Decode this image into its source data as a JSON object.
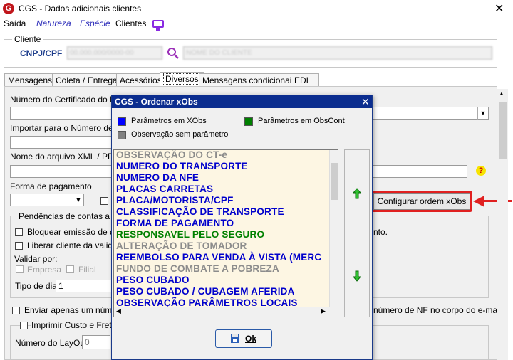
{
  "window": {
    "title": "CGS - Dados adicionais clientes",
    "close": "✕"
  },
  "menu": {
    "items": [
      "Saída",
      "Natureza",
      "Espécie",
      "Clientes"
    ]
  },
  "cliente": {
    "group_label": "Cliente",
    "cnpj_label": "CNPJ/CPF",
    "cnpj_value": "00.000.000/0000-00",
    "name_value": "NOME DO CLIENTE"
  },
  "tabs": [
    "Mensagens",
    "Coleta / Entrega",
    "Acessórios",
    "Diversos",
    "Mensagens condicionais",
    "EDI"
  ],
  "form": {
    "certificado_label": "Número do Certificado do Reg",
    "importar_label": "Importar para o Número de tra",
    "xml_label": "Nome do arquivo XML / PDF",
    "forma_pagamento_label": "Forma de pagamento",
    "pendencias_label": "Pendências de contas a rece",
    "bloquear_label": "Bloquear emissão de doc",
    "liberar_label": "Liberar cliente da valida",
    "validar_label": "Validar por:",
    "empresa_label": "Empresa",
    "filial_label": "Filial",
    "tipo_dia_label": "Tipo de dia",
    "tipo_dia_value": "1",
    "enviar_label": "Enviar apenas um número",
    "enviar_right": "número de NF no corpo do e-mail",
    "nto_fragment": "nto.",
    "imprimir_label": "Imprimir Custo e Frete p",
    "layout_label": "Número do LayOut",
    "layout_value": "0",
    "question_mark": "?"
  },
  "config_button": {
    "label": "Configurar ordem xObs"
  },
  "dialog": {
    "title": "CGS - Ordenar xObs",
    "close": "✕",
    "legend": [
      {
        "label": "Parâmetros em XObs",
        "color": "#0000ff"
      },
      {
        "label": "Parâmetros em ObsCont",
        "color": "#008000"
      },
      {
        "label": "Observação sem parâmetro",
        "color": "#808080"
      }
    ],
    "items": [
      {
        "text": "OBSERVAÇÃO DO CT-e",
        "color": "#8c8c8c"
      },
      {
        "text": "NUMERO DO TRANSPORTE",
        "color": "#0000cc"
      },
      {
        "text": "NUMERO DA NFE",
        "color": "#0000cc"
      },
      {
        "text": "PLACAS CARRETAS",
        "color": "#0000cc"
      },
      {
        "text": "PLACA/MOTORISTA/CPF",
        "color": "#0000cc"
      },
      {
        "text": "CLASSIFICAÇÃO DE TRANSPORTE",
        "color": "#0000cc"
      },
      {
        "text": "FORMA DE PAGAMENTO",
        "color": "#0000cc"
      },
      {
        "text": "RESPONSAVEL PELO SEGURO",
        "color": "#008000"
      },
      {
        "text": "ALTERAÇÃO DE TOMADOR",
        "color": "#8c8c8c"
      },
      {
        "text": "REEMBOLSO PARA VENDA À VISTA (MERC",
        "color": "#0000cc"
      },
      {
        "text": "FUNDO DE COMBATE A POBREZA",
        "color": "#8c8c8c"
      },
      {
        "text": "PESO CUBADO",
        "color": "#0000cc"
      },
      {
        "text": "PESO CUBADO / CUBAGEM AFERIDA",
        "color": "#0000cc"
      },
      {
        "text": "OBSERVAÇÃO PARÂMETROS LOCAIS",
        "color": "#0000cc"
      }
    ],
    "ok_label": "Ok"
  },
  "icons": [
    "app-logo-icon",
    "monitor-icon",
    "search-icon",
    "arrow-up-icon",
    "arrow-down-icon",
    "save-icon",
    "help-icon"
  ]
}
